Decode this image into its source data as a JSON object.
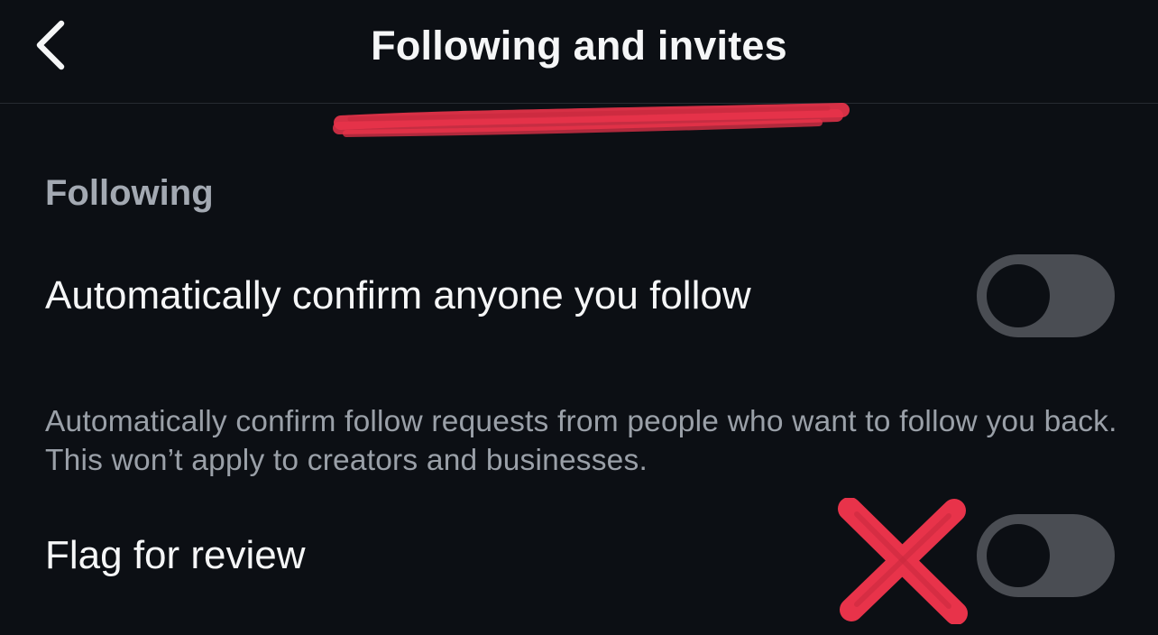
{
  "header": {
    "title": "Following and invites",
    "back_icon": "chevron-left-icon"
  },
  "colors": {
    "background": "#0c0f14",
    "primary_text": "#f5f6f7",
    "secondary_text": "#9aa0a8",
    "toggle_off_track": "#4a4d53",
    "annotation_red": "#e8334a"
  },
  "section": {
    "label": "Following"
  },
  "settings": [
    {
      "label": "Automatically confirm anyone you follow",
      "enabled": false
    },
    {
      "label": "Flag for review",
      "enabled": false
    }
  ],
  "helper_text": "Automatically confirm follow requests from people who want to follow you back. This won’t apply to creators and businesses."
}
